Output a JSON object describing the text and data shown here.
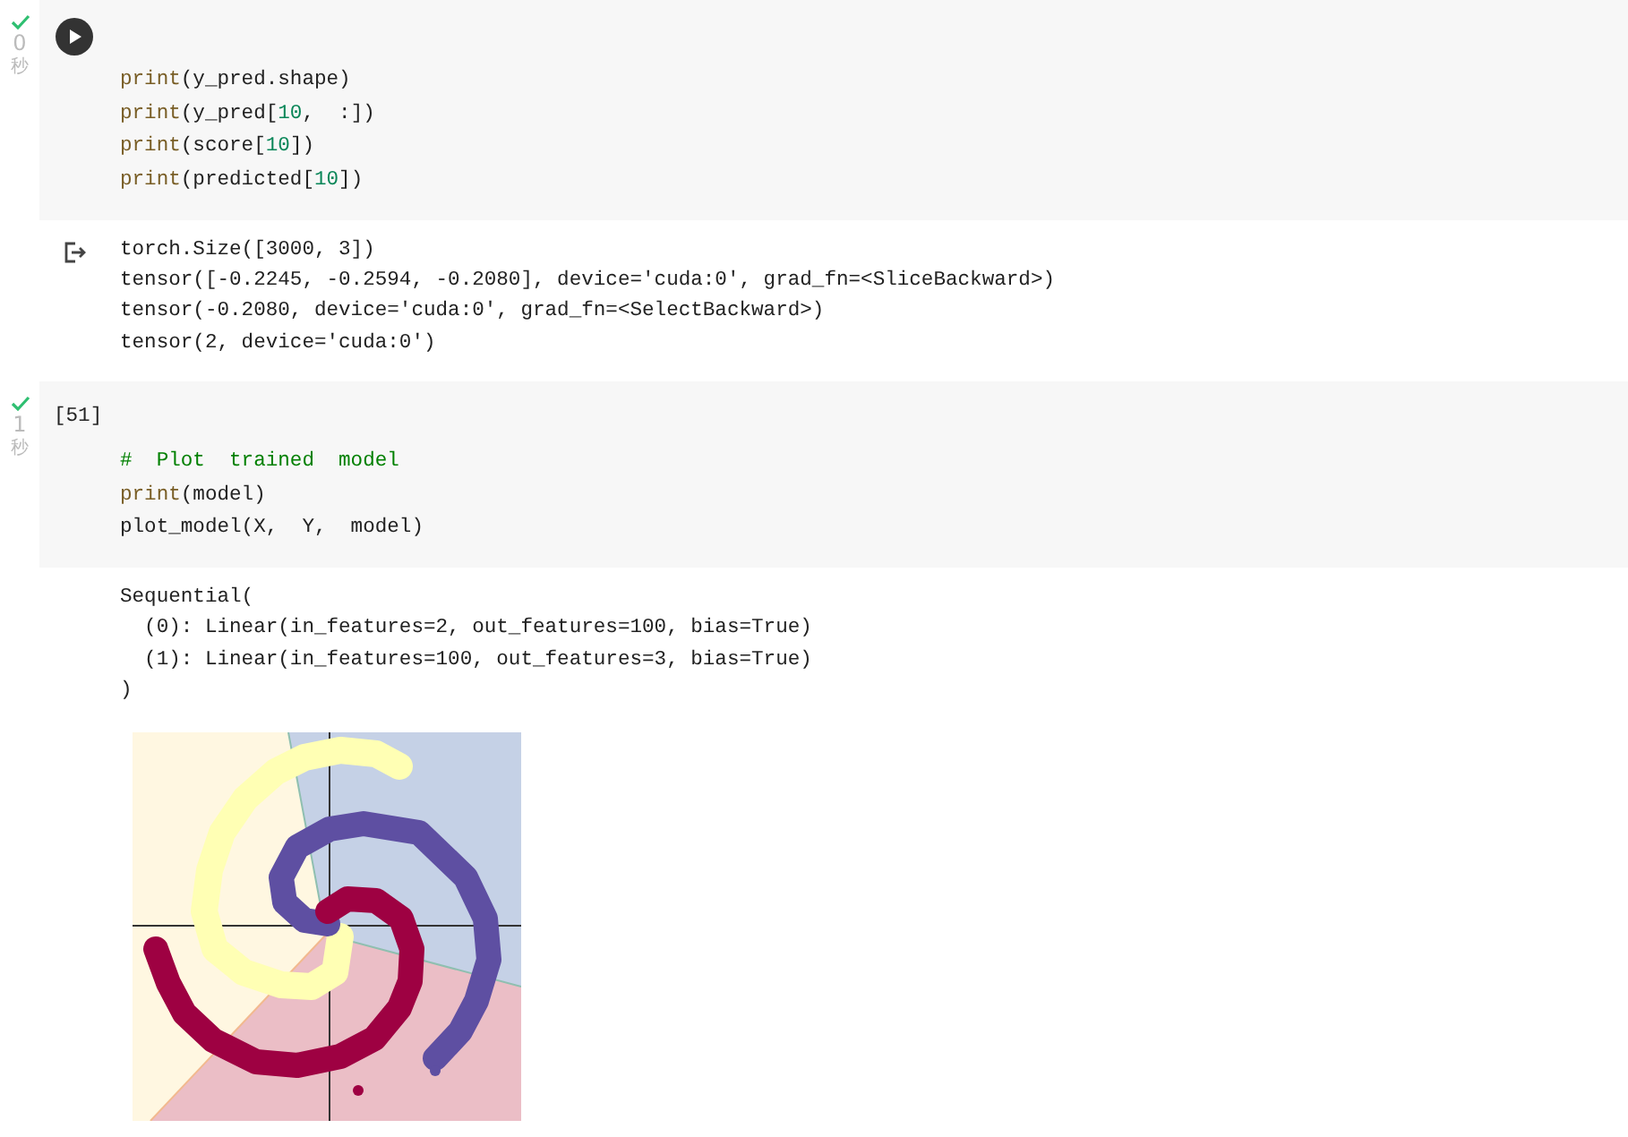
{
  "cells": [
    {
      "succeeded": true,
      "time": "0",
      "unit": "秒",
      "run_button": true,
      "code": [
        [
          {
            "kind": "builtin",
            "text": "print"
          },
          {
            "kind": "plain",
            "text": "(y_pred.shape)"
          }
        ],
        [
          {
            "kind": "builtin",
            "text": "print"
          },
          {
            "kind": "plain",
            "text": "(y_pred["
          },
          {
            "kind": "number",
            "text": "10"
          },
          {
            "kind": "plain",
            "text": ",  :])"
          }
        ],
        [
          {
            "kind": "builtin",
            "text": "print"
          },
          {
            "kind": "plain",
            "text": "(score["
          },
          {
            "kind": "number",
            "text": "10"
          },
          {
            "kind": "plain",
            "text": "])"
          }
        ],
        [
          {
            "kind": "builtin",
            "text": "print"
          },
          {
            "kind": "plain",
            "text": "(predicted["
          },
          {
            "kind": "number",
            "text": "10"
          },
          {
            "kind": "plain",
            "text": "])"
          }
        ]
      ],
      "output": {
        "output_icon": true,
        "lines": [
          "torch.Size([3000, 3])",
          "tensor([-0.2245, -0.2594, -0.2080], device='cuda:0', grad_fn=<SliceBackward>)",
          "tensor(-0.2080, device='cuda:0', grad_fn=<SelectBackward>)",
          "tensor(2, device='cuda:0')"
        ]
      }
    },
    {
      "succeeded": true,
      "time": "1",
      "unit": "秒",
      "execution_count": "[51]",
      "code": [
        [
          {
            "kind": "comment",
            "text": "#  Plot  trained  model"
          }
        ],
        [
          {
            "kind": "builtin",
            "text": "print"
          },
          {
            "kind": "plain",
            "text": "(model)"
          }
        ],
        [
          {
            "kind": "plain",
            "text": "plot_model(X,  Y,  model)"
          }
        ]
      ],
      "output": {
        "lines": [
          "Sequential(",
          "  (0): Linear(in_features=2, out_features=100, bias=True)",
          "  (1): Linear(in_features=100, out_features=3, bias=True)",
          ")"
        ],
        "figure": {
          "kind": "spiral_scatter"
        }
      }
    }
  ]
}
